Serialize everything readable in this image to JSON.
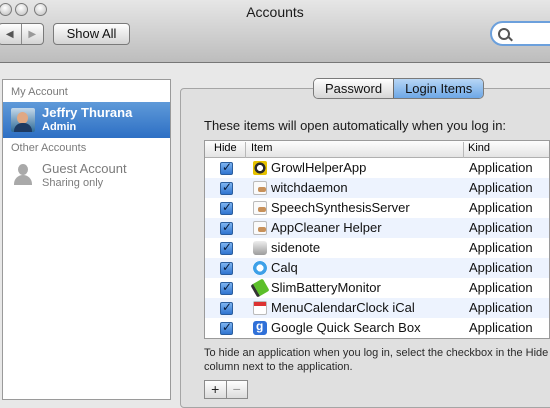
{
  "window": {
    "title": "Accounts"
  },
  "toolbar": {
    "back_icon": "back-arrow-icon",
    "forward_icon": "forward-arrow-icon",
    "show_all_label": "Show All",
    "search_icon": "magnifier-icon"
  },
  "sidebar": {
    "my_account_heading": "My Account",
    "other_accounts_heading": "Other Accounts",
    "accounts": [
      {
        "name": "Jeffry Thurana",
        "role": "Admin",
        "selected": true
      },
      {
        "name": "Guest Account",
        "role": "Sharing only",
        "selected": false
      }
    ]
  },
  "tabs": [
    {
      "label": "Password",
      "active": false
    },
    {
      "label": "Login Items",
      "active": true
    }
  ],
  "login_items": {
    "intro": "These items will open automatically when you log in:",
    "columns": {
      "hide": "Hide",
      "item": "Item",
      "kind": "Kind"
    },
    "rows": [
      {
        "name": "GrowlHelperApp",
        "kind": "Application",
        "hide": true,
        "icon": "growl-icon"
      },
      {
        "name": "witchdaemon",
        "kind": "Application",
        "hide": true,
        "icon": "document-icon"
      },
      {
        "name": "SpeechSynthesisServer",
        "kind": "Application",
        "hide": true,
        "icon": "document-icon"
      },
      {
        "name": "AppCleaner Helper",
        "kind": "Application",
        "hide": true,
        "icon": "document-icon"
      },
      {
        "name": "sidenote",
        "kind": "Application",
        "hide": true,
        "icon": "sidenote-icon"
      },
      {
        "name": "Calq",
        "kind": "Application",
        "hide": true,
        "icon": "calq-icon"
      },
      {
        "name": "SlimBatteryMonitor",
        "kind": "Application",
        "hide": true,
        "icon": "battery-icon"
      },
      {
        "name": "MenuCalendarClock iCal",
        "kind": "Application",
        "hide": true,
        "icon": "calendar-icon"
      },
      {
        "name": "Google Quick Search Box",
        "kind": "Application",
        "hide": true,
        "icon": "google-icon"
      }
    ],
    "hint": "To hide an application when you log in, select the checkbox in the Hide column next to the application.",
    "add_label": "+",
    "remove_label": "−"
  },
  "colors": {
    "selection": "#3a7bd0",
    "checkbox": "#3b82d8",
    "alt_row": "#edf3fe"
  }
}
